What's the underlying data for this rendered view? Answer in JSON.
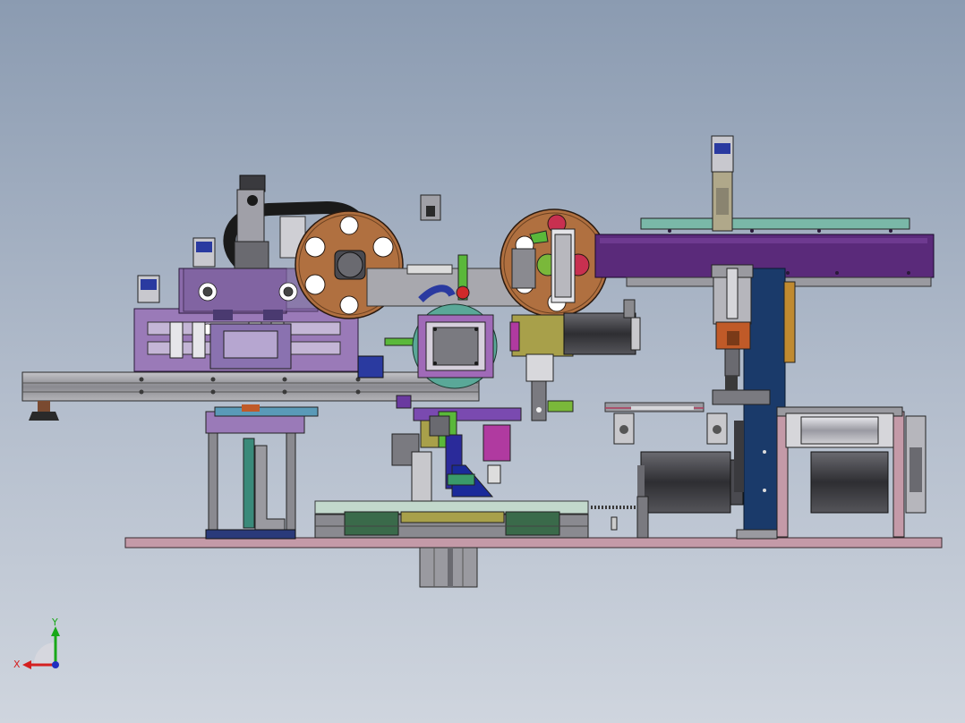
{
  "viewport": {
    "background_top": "#8b9bb1",
    "background_bottom": "#cfd5de"
  },
  "triad": {
    "x_label": "X",
    "y_label": "Y",
    "x_color": "#d42020",
    "y_color": "#18a818",
    "z_color": "#2030c0"
  },
  "palette": {
    "wood_reel": "#b07040",
    "purple_panel": "#9a7ab8",
    "violet_frame": "#5a2a7a",
    "teal_plate": "#5aa898",
    "navy_column": "#1a3a6a",
    "steel_grey": "#9a9aa0",
    "dark_motor": "#3a3a3e",
    "base_plate": "#c49aa8",
    "olive_block": "#a8a04a",
    "orange_block": "#c05a28"
  }
}
